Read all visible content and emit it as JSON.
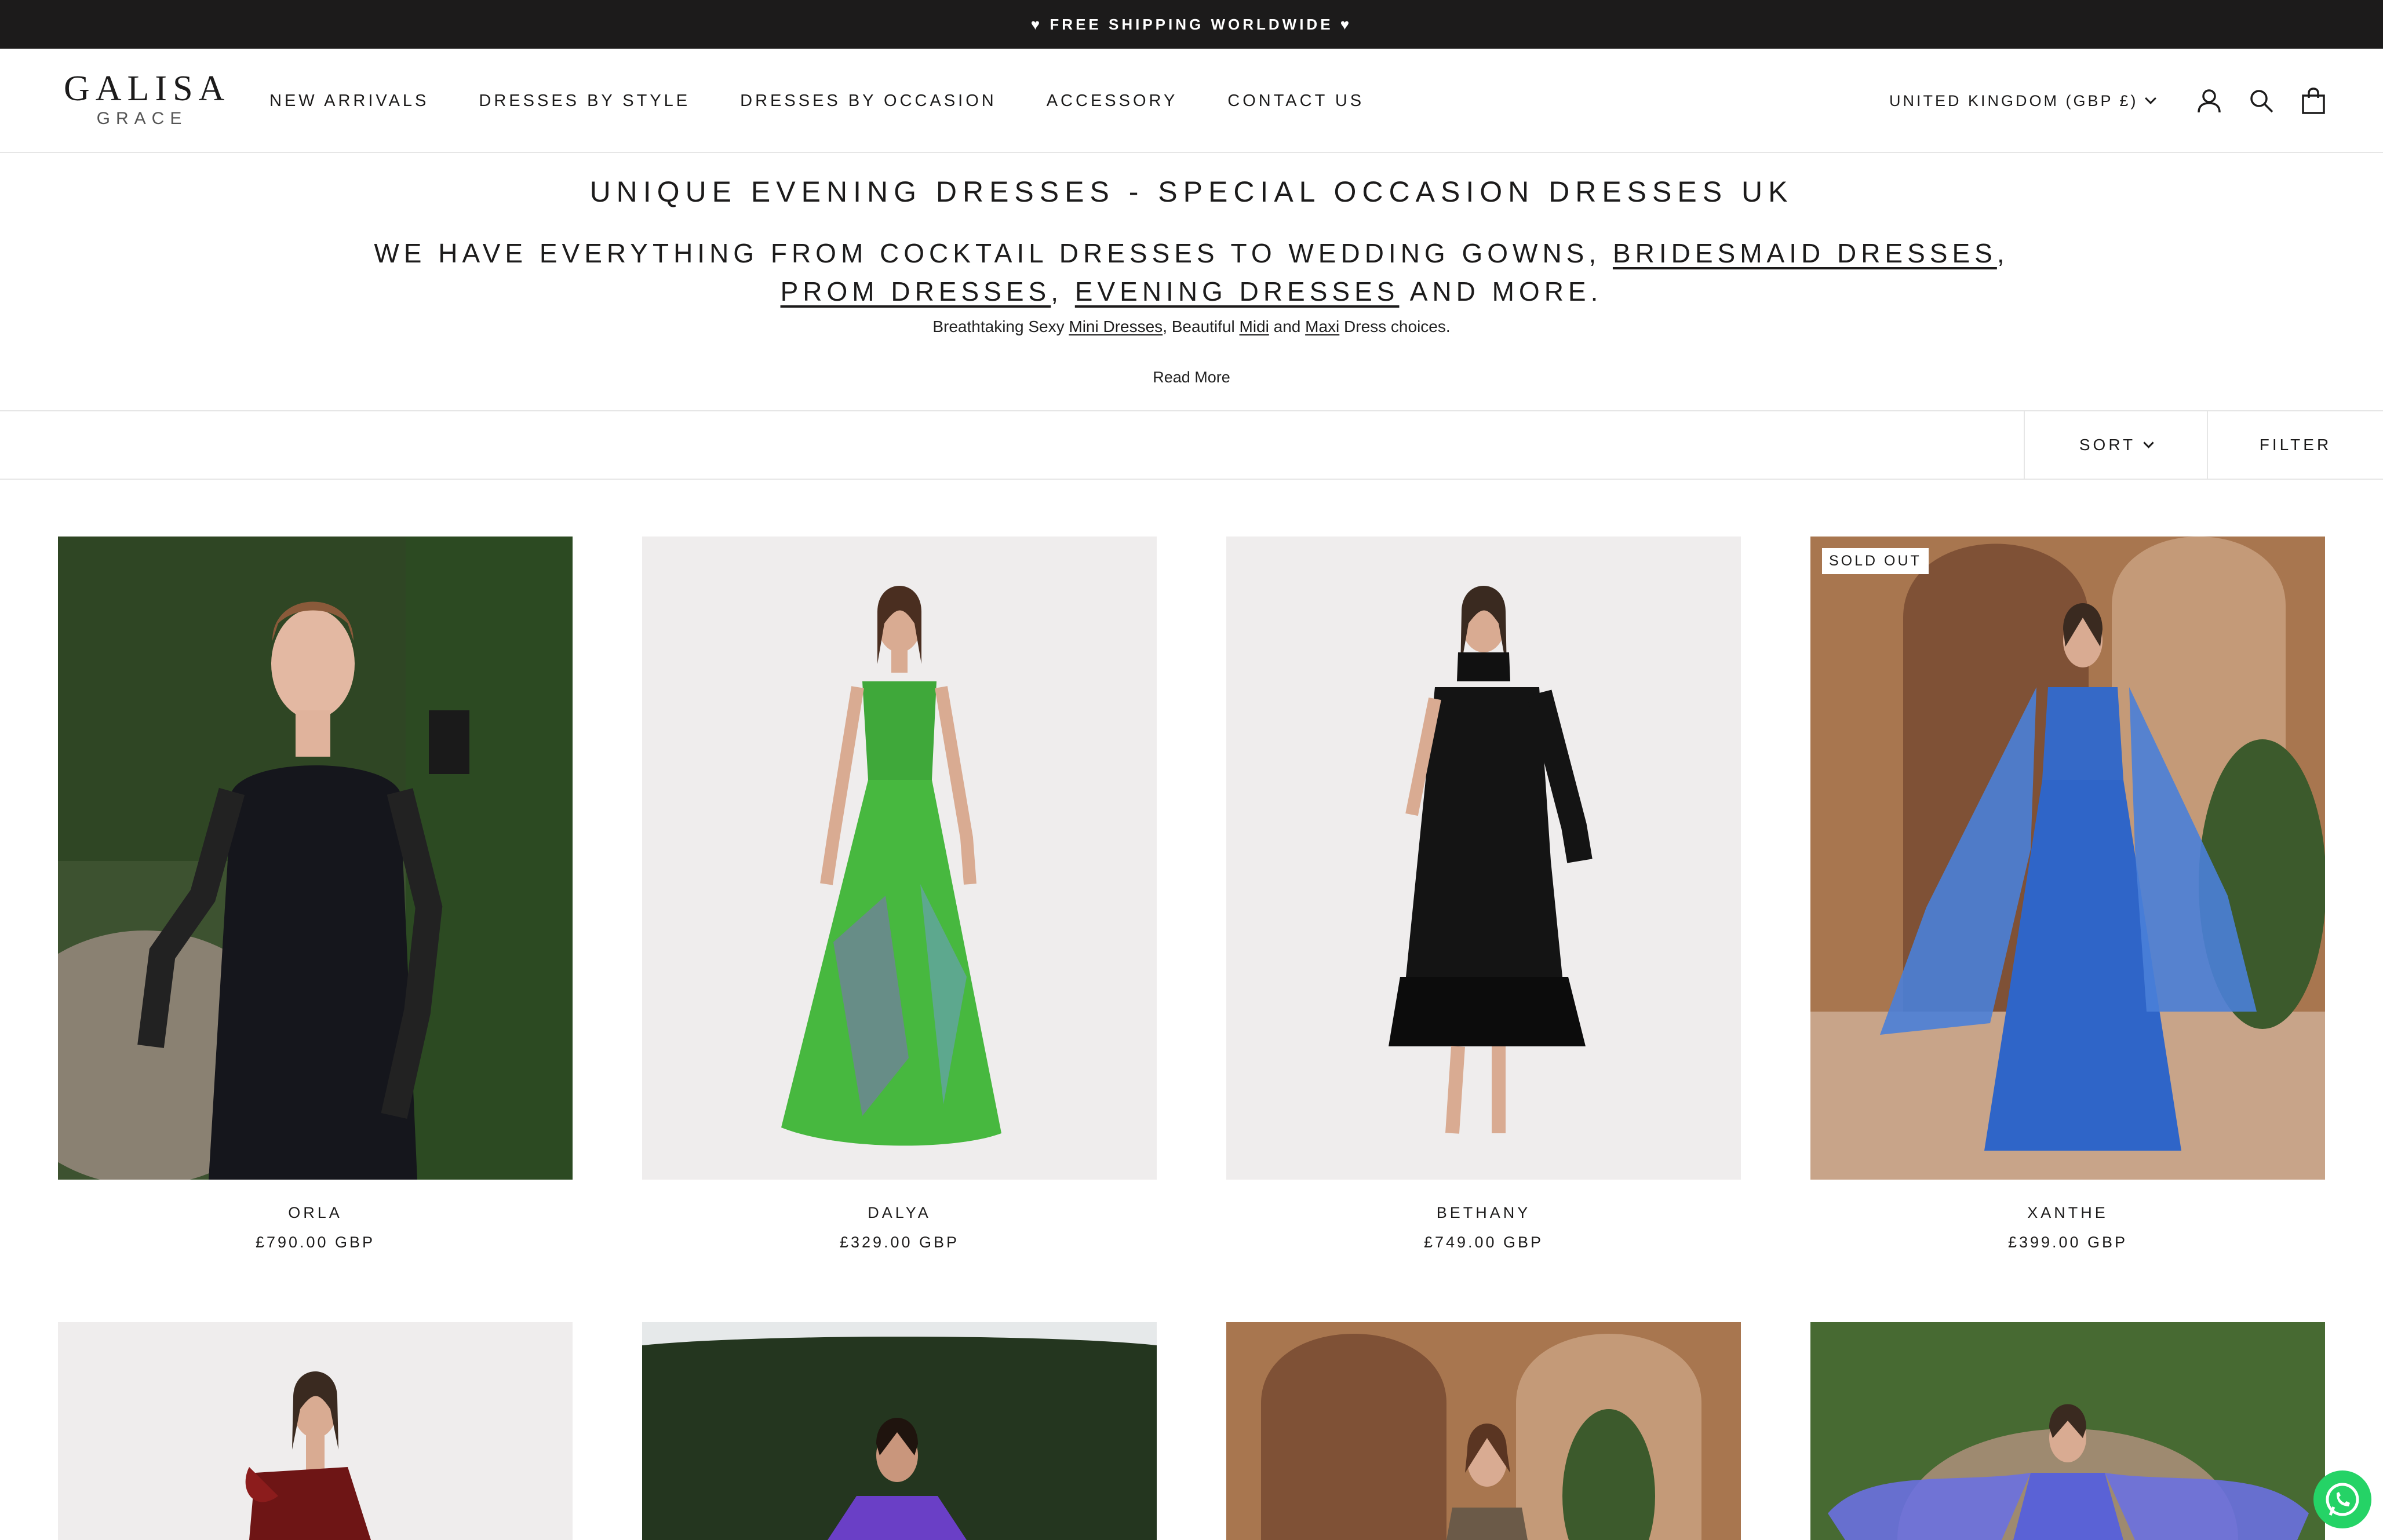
{
  "announcement": "♥ FREE SHIPPING WORLDWIDE ♥",
  "brand": {
    "name": "GALISA",
    "sub": "GRACE"
  },
  "nav": [
    "NEW ARRIVALS",
    "DRESSES BY STYLE",
    "DRESSES BY OCCASION",
    "ACCESSORY",
    "CONTACT US"
  ],
  "currency": "UNITED KINGDOM (GBP £)",
  "intro": {
    "heading": "UNIQUE EVENING DRESSES - SPECIAL OCCASION DRESSES UK",
    "sub_part1": "WE HAVE EVERYTHING FROM COCKTAIL DRESSES TO WEDDING GOWNS, ",
    "link_bridesmaid": "BRIDESMAID DRESSES",
    "sep1": ", ",
    "link_prom": "PROM DRESSES",
    "sep2": ", ",
    "link_evening": "EVENING DRESSES",
    "sub_end": " AND MORE.",
    "desc_start": "Breathtaking Sexy ",
    "link_mini": "Mini Dresses",
    "desc_mid1": ", Beautiful ",
    "link_midi": "Midi",
    "desc_mid2": " and ",
    "link_maxi": "Maxi",
    "desc_end": " Dress choices.",
    "read_more": "Read More"
  },
  "toolbar": {
    "sort": "SORT",
    "filter": "FILTER"
  },
  "products": [
    {
      "name": "ORLA",
      "price": "£790.00 GBP",
      "badge": ""
    },
    {
      "name": "DALYA",
      "price": "£329.00 GBP",
      "badge": ""
    },
    {
      "name": "BETHANY",
      "price": "£749.00 GBP",
      "badge": ""
    },
    {
      "name": "XANTHE",
      "price": "£399.00 GBP",
      "badge": "SOLD OUT"
    }
  ],
  "colors": {
    "dark": "#1c1b1b",
    "border": "#e6e6e6",
    "whatsapp": "#25d366"
  },
  "icons": [
    "account-icon",
    "search-icon",
    "bag-icon",
    "whatsapp-icon"
  ]
}
